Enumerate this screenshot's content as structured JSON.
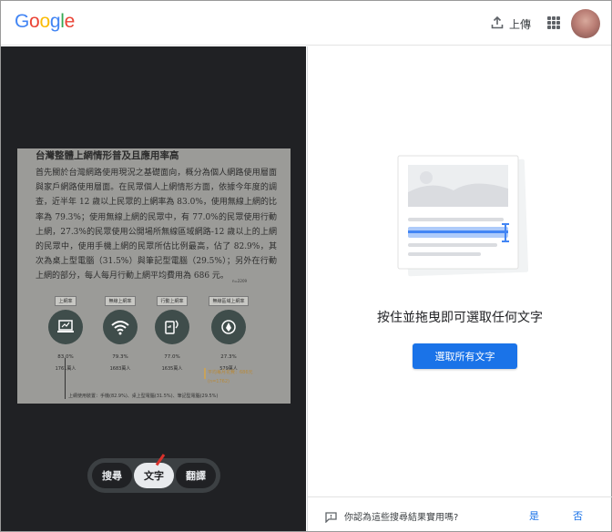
{
  "header": {
    "logo_letters": [
      {
        "char": "G",
        "color": "#4285F4"
      },
      {
        "char": "o",
        "color": "#EA4335"
      },
      {
        "char": "o",
        "color": "#FBBC05"
      },
      {
        "char": "g",
        "color": "#4285F4"
      },
      {
        "char": "l",
        "color": "#34A853"
      },
      {
        "char": "e",
        "color": "#EA4335"
      }
    ],
    "upload_label": "上傳",
    "upload_icon": "upload-icon",
    "apps_icon": "apps-grid-icon"
  },
  "document": {
    "title": "台灣整體上網情形普及且應用率高",
    "paragraph": "首先關於台灣網路使用現況之基礎面向，概分為個人網路使用層面與家戶網路使用層面。在民眾個人上網情形方面，依據今年度的調查，近半年 12 歲以上民眾的上網率為 83.0%，使用無線上網的比率為 79.3%；使用無線上網的民眾中，有 77.0%的民眾使用行動上網，27.3%的民眾使用公開場所無線區域網路-12 歲以上的上網的民眾中，使用手機上網的民眾所估比例最高，佔了 82.9%，其次為桌上型電腦（31.5%）與筆記型電腦（29.5%）；另外在行動上網的部分，每人每月行動上網平均費用為 686 元。",
    "note": "n=2209",
    "stats": [
      {
        "label": "上網率",
        "pct": "83.0%",
        "count": "1761萬人",
        "icon": "laptop-icon"
      },
      {
        "label": "無線上網率",
        "pct": "79.3%",
        "count": "1683萬人",
        "icon": "wifi-icon"
      },
      {
        "label": "行動上網率",
        "pct": "77.0%",
        "count": "1635萬人",
        "icon": "mobile-network-icon"
      },
      {
        "label": "無線區域上網率",
        "pct": "27.3%",
        "count": "579萬人",
        "icon": "location-wifi-icon"
      }
    ],
    "highlight_line1": "平均每月花費：686元",
    "highlight_line2": "(n=1762)",
    "footer": "上網使用裝置：手機(82.9%)、桌上型電腦(31.5%)、筆記型電腦(29.5%)"
  },
  "modes": {
    "search": "搜尋",
    "text": "文字",
    "translate": "翻譯",
    "active": "text"
  },
  "right_panel": {
    "prompt": "按住並拖曳即可選取任何文字",
    "select_all": "選取所有文字",
    "illustration_icon": "text-selection-illustration"
  },
  "feedback": {
    "question": "你認為這些搜尋結果實用嗎?",
    "yes": "是",
    "no": "否",
    "icon": "feedback-icon"
  },
  "colors": {
    "accent": "#1a73e8",
    "dark_panel": "#202124",
    "annotation": "#d9312b"
  }
}
